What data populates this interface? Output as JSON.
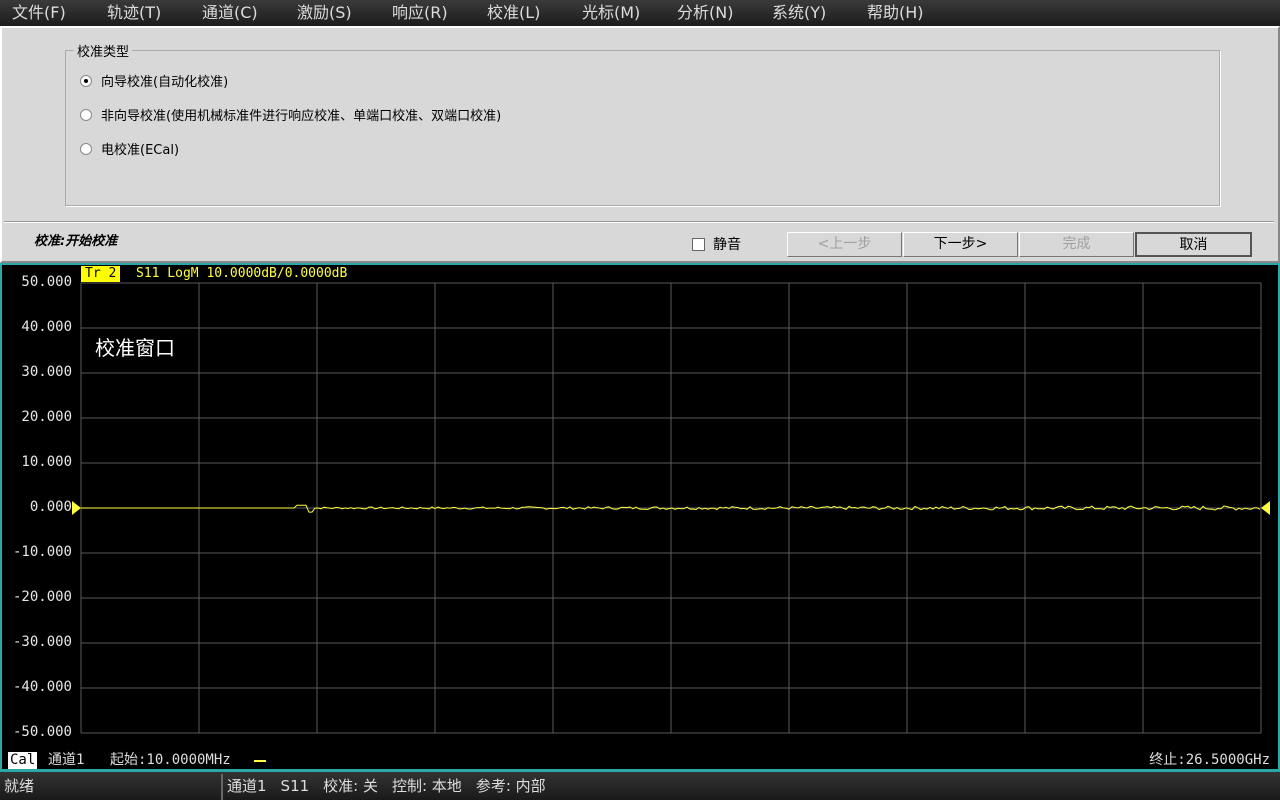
{
  "menu": [
    "文件(F)",
    "轨迹(T)",
    "通道(C)",
    "激励(S)",
    "响应(R)",
    "校准(L)",
    "光标(M)",
    "分析(N)",
    "系统(Y)",
    "帮助(H)"
  ],
  "dialog": {
    "group_title": "校准类型",
    "options": [
      {
        "label": "向导校准(自动化校准)",
        "selected": true
      },
      {
        "label": "非向导校准(使用机械标准件进行响应校准、单端口校准、双端口校准)",
        "selected": false
      },
      {
        "label": "电校准(ECal)",
        "selected": false
      }
    ],
    "step_label": "校准:开始校准",
    "mute_label": "静音",
    "mute_checked": false,
    "buttons": {
      "prev": "<上一步",
      "next": "下一步>",
      "finish": "完成",
      "cancel": "取消"
    }
  },
  "chart": {
    "trace_tag": "Tr 2",
    "trace_info": "S11 LogM 10.0000dB/0.0000dB",
    "window_label": "校准窗口",
    "cal_tag": "Cal",
    "channel": "通道1",
    "start": "起始:10.0000MHz",
    "stop": "终止:26.5000GHz",
    "colors": {
      "trace": "#ffff40",
      "grid": "#5a5a5a",
      "border": "#2aa7a7"
    }
  },
  "chart_data": {
    "type": "line",
    "ylabel": "dB",
    "ylim": [
      -50,
      50
    ],
    "yticks": [
      "50.000",
      "40.000",
      "30.000",
      "20.000",
      "10.000",
      "0.000",
      "-10.000",
      "-20.000",
      "-30.000",
      "-40.000",
      "-50.000"
    ],
    "xlim": [
      "10.0000MHz",
      "26.5000GHz"
    ],
    "reference_value": 0,
    "series": [
      {
        "name": "S11",
        "approx_value": 0
      }
    ]
  },
  "status": {
    "ready": "就绪",
    "items": [
      "通道1",
      "S11",
      "校准: 关",
      "控制: 本地",
      "参考: 内部"
    ]
  }
}
